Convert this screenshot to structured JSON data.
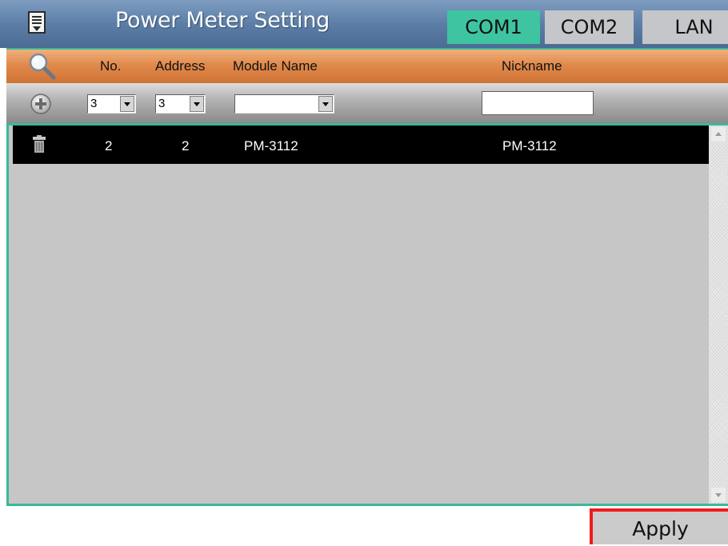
{
  "header": {
    "title": "Power Meter Setting",
    "tabs": [
      {
        "label": "COM1",
        "active": true
      },
      {
        "label": "COM2",
        "active": false
      },
      {
        "label": "LAN",
        "active": false
      }
    ]
  },
  "columns": {
    "no": "No.",
    "address": "Address",
    "module_name": "Module Name",
    "nickname": "Nickname"
  },
  "add_row": {
    "no_value": "3",
    "address_value": "3",
    "module_name_value": "",
    "nickname_value": ""
  },
  "rows": [
    {
      "no": "2",
      "address": "2",
      "module_name": "PM-3112",
      "nickname": "PM-3112"
    }
  ],
  "apply_label": "Apply",
  "colors": {
    "title_bar": "#5c7ea6",
    "active_tab": "#3ec4a0",
    "inactive_tab": "#c4c6c9",
    "header_row": "#e08a4c",
    "accent": "#3ab89a",
    "apply_border": "#ee1c1c"
  },
  "icons": [
    "menu-icon",
    "search-icon",
    "add-icon",
    "trash-icon"
  ]
}
